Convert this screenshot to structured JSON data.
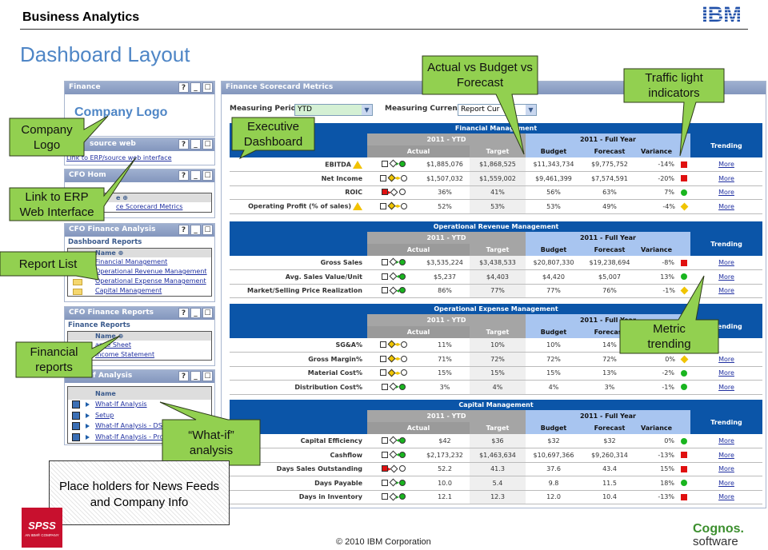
{
  "header": {
    "title": "Business Analytics",
    "brand": "IBM",
    "page_title": "Dashboard Layout"
  },
  "portlets": {
    "finance": {
      "title": "Finance",
      "logo_text": "Company Logo"
    },
    "source_web": {
      "title": "source web",
      "link": "Link to ERP/source web interface"
    },
    "cfo_home": {
      "title": "CFO Hom",
      "name_header": "e ⊕",
      "link": "ce Scorecard Metrics"
    },
    "analysis": {
      "title": "CFO Finance Analysis",
      "subtitle": "Dashboard Reports",
      "name_header": "Name ⊕",
      "items": [
        "Financial Management",
        "Operational Revenue Management",
        "Operational Expense Management",
        "Capital Management"
      ]
    },
    "reports": {
      "title": "CFO Finance Reports",
      "subtitle": "Finance Reports",
      "name_header": "Name ⊕",
      "items": [
        "ance Sheet",
        "Income Statement"
      ]
    },
    "whatif": {
      "title": "f Analysis",
      "name_header": "Name",
      "items": [
        "What-If Analysis",
        "Setup",
        "What-If Analysis - DSO",
        "What-If Analysis - Pro"
      ]
    },
    "buttons": {
      "help": "?",
      "minimize": "_",
      "maximize": "☐"
    }
  },
  "main": {
    "title": "Finance Scorecard Metrics",
    "period_label": "Measuring Period:",
    "period_value": "YTD",
    "currency_label": "Measuring Currency:",
    "currency_value": "Report Cur"
  },
  "table_labels": {
    "ytd": "2011 - YTD",
    "fy": "2011 - Full Year",
    "actual": "Actual",
    "target": "Target",
    "budget": "Budget",
    "forecast": "Forecast",
    "variance": "Variance",
    "trending": "Trending"
  },
  "colors": {
    "green": "#19b51f",
    "yellow": "#f0c400",
    "red": "#e01010",
    "header_blue": "#0b55a8",
    "callout": "#92d050"
  },
  "sections": [
    {
      "title": "Financial Management",
      "rows": [
        {
          "metric": "EBITDA",
          "warn": true,
          "status": "green",
          "trend": "right",
          "actual": "$1,885,076",
          "target": "$1,868,525",
          "budget": "$11,343,734",
          "forecast": "$9,775,752",
          "variance": "-14%",
          "variance_status": "red",
          "trending": "More"
        },
        {
          "metric": "Net Income",
          "warn": false,
          "status": "yellow",
          "trend": "both",
          "actual": "$1,507,032",
          "target": "$1,559,002",
          "budget": "$9,461,399",
          "forecast": "$7,574,591",
          "variance": "-20%",
          "variance_status": "red",
          "trending": "More"
        },
        {
          "metric": "ROIC",
          "warn": false,
          "status": "red",
          "trend": "right",
          "actual": "36%",
          "target": "41%",
          "budget": "56%",
          "forecast": "63%",
          "variance": "7%",
          "variance_status": "green",
          "trending": "More"
        },
        {
          "metric": "Operating Profit (% of sales)",
          "warn": true,
          "status": "yellow",
          "trend": "both",
          "actual": "52%",
          "target": "53%",
          "budget": "53%",
          "forecast": "49%",
          "variance": "-4%",
          "variance_status": "yellow",
          "trending": "More"
        }
      ]
    },
    {
      "title": "Operational Revenue Management",
      "rows": [
        {
          "metric": "Gross Sales",
          "status": "green",
          "trend": "right",
          "actual": "$3,535,224",
          "target": "$3,438,533",
          "budget": "$20,807,330",
          "forecast": "$19,238,694",
          "variance": "-8%",
          "variance_status": "red",
          "trending": "More"
        },
        {
          "metric": "Avg. Sales Value/Unit",
          "status": "green",
          "trend": "left",
          "actual": "$5,237",
          "target": "$4,403",
          "budget": "$4,420",
          "forecast": "$5,007",
          "variance": "13%",
          "variance_status": "green",
          "trending": "More"
        },
        {
          "metric": "Market/Selling Price Realization",
          "status": "green",
          "trend": "left",
          "actual": "86%",
          "target": "77%",
          "budget": "77%",
          "forecast": "76%",
          "variance": "-1%",
          "variance_status": "yellow",
          "trending": "More"
        }
      ]
    },
    {
      "title": "Operational Expense Management",
      "rows": [
        {
          "metric": "SG&A%",
          "status": "yellow",
          "trend": "both",
          "actual": "11%",
          "target": "10%",
          "budget": "10%",
          "forecast": "14%",
          "variance": null,
          "variance_status": null,
          "trending": null
        },
        {
          "metric": "Gross Margin%",
          "status": "yellow",
          "trend": "both",
          "actual": "71%",
          "target": "72%",
          "budget": "72%",
          "forecast": "72%",
          "variance": "0%",
          "variance_status": "yellow",
          "trending": "More"
        },
        {
          "metric": "Material Cost%",
          "status": "yellow",
          "trend": "both",
          "actual": "15%",
          "target": "15%",
          "budget": "15%",
          "forecast": "13%",
          "variance": "-2%",
          "variance_status": "green",
          "trending": "More"
        },
        {
          "metric": "Distribution Cost%",
          "status": "green",
          "trend": "right",
          "actual": "3%",
          "target": "4%",
          "budget": "4%",
          "forecast": "3%",
          "variance": "-1%",
          "variance_status": "green",
          "trending": "More"
        }
      ]
    },
    {
      "title": "Capital Management",
      "rows": [
        {
          "metric": "Capital Efficiency",
          "status": "green",
          "trend": "left",
          "actual": "$42",
          "target": "$36",
          "budget": "$32",
          "forecast": "$32",
          "variance": "0%",
          "variance_status": "green",
          "trending": "More"
        },
        {
          "metric": "Cashflow",
          "status": "green",
          "trend": "left",
          "actual": "$2,173,232",
          "target": "$1,463,634",
          "budget": "$10,697,366",
          "forecast": "$9,260,314",
          "variance": "-13%",
          "variance_status": "red",
          "trending": "More"
        },
        {
          "metric": "Days Sales Outstanding",
          "status": "red",
          "trend": "right",
          "actual": "52.2",
          "target": "41.3",
          "budget": "37.6",
          "forecast": "43.4",
          "variance": "15%",
          "variance_status": "red",
          "trending": "More"
        },
        {
          "metric": "Days Payable",
          "status": "green",
          "trend": "right",
          "actual": "10.0",
          "target": "5.4",
          "budget": "9.8",
          "forecast": "11.5",
          "variance": "18%",
          "variance_status": "green",
          "trending": "More"
        },
        {
          "metric": "Days in Inventory",
          "status": "green",
          "trend": "right",
          "actual": "12.1",
          "target": "12.3",
          "budget": "12.0",
          "forecast": "10.4",
          "variance": "-13%",
          "variance_status": "red",
          "trending": "More"
        }
      ]
    }
  ],
  "callouts": {
    "actual_budget": "Actual vs Budget vs Forecast",
    "traffic": "Traffic light indicators",
    "company_logo": "Company Logo",
    "exec": "Executive Dashboard",
    "erp": "Link to ERP Web Interface",
    "report_list": "Report List",
    "fin_reports": "Financial reports",
    "whatif": "“What-if” analysis",
    "trending": "Metric trending"
  },
  "placeholder": "Place holders for News Feeds and Company Info",
  "footer": {
    "copyright": "© 2010 IBM Corporation",
    "spss": "SPSS",
    "spss_sub": "AN IBM® COMPANY",
    "cognos": "Cognos.",
    "cognos_sub": "software"
  }
}
